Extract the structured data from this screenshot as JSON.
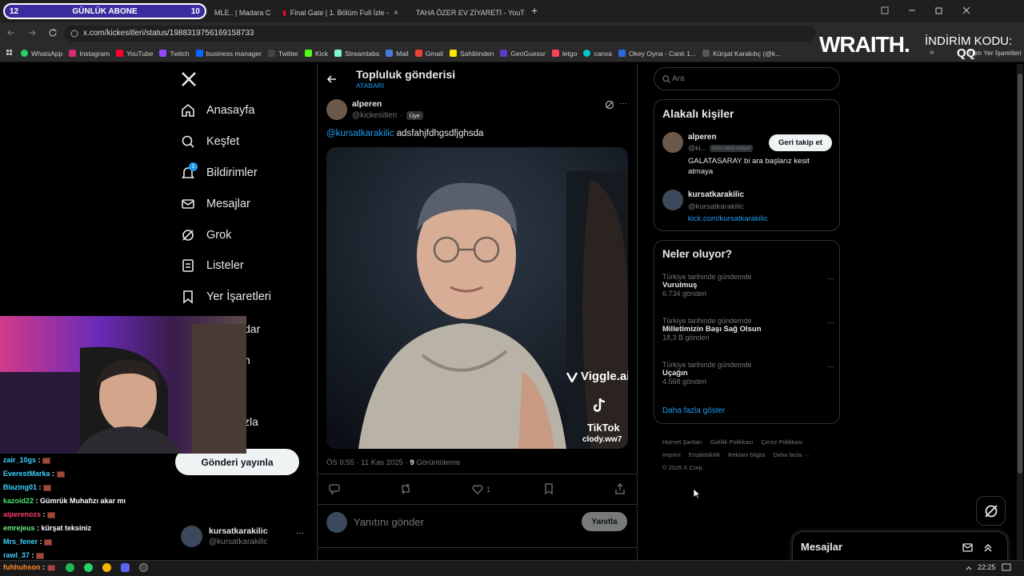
{
  "subgoal": {
    "current": "12",
    "label": "GÜNLÜK ABONE",
    "target": "10"
  },
  "tabs": [
    {
      "label": "MLE.. | Madara C",
      "close": "×"
    },
    {
      "label": "Final Gate | 1. Bölüm Full İzle -",
      "close": "×"
    },
    {
      "label": "TAHA ÖZER EV ZİYARETİ - YouT",
      "close": "×"
    }
  ],
  "new_tab": "+",
  "url": "x.com/kickesitleri/status/1988319756169158733",
  "bookmarks": [
    "WhatsApp",
    "Instagram",
    "YouTube",
    "Twitch",
    "business manager",
    "Twitter",
    "Kick",
    "Streamlabs",
    "Mail",
    "Gmail",
    "Sahibinden",
    "GeoGuessr",
    "letgo",
    "canva",
    "Okey Oyna - Canlı 1...",
    "Kürşat Karakılıç (@k..."
  ],
  "bookmarks_more": "»",
  "bookmarks_folder": "Tüm Yer İşaretleri",
  "overlay": {
    "brand": "WRAITH.",
    "promo": "İNDİRİM KODU:",
    "code": "QQ"
  },
  "nav": {
    "items": [
      "Anasayfa",
      "Keşfet",
      "Bildirimler",
      "Mesajlar",
      "Grok",
      "Listeler",
      "Yer İşaretleri"
    ],
    "notif_count": "1",
    "post_button": "Gönderi yayınla",
    "account_name": "kursatkarakilic",
    "account_handle": "@kursatkarakilic",
    "more": "···"
  },
  "post": {
    "header_title": "Topluluk gönderisi",
    "header_sub": "ATABARI",
    "author": "alperen",
    "handle": "@kickesitleri",
    "dot": "·",
    "badge": "Üye",
    "mention": "@kursatkarakilic",
    "text": " adsfahjfdhgsdfjghsda",
    "watermark1": "Viggle.ai",
    "watermark2": "TikTok",
    "watermark3": "clody.ww7",
    "time": "ÖS 9:55 · 11 Kas 2025 · ",
    "views": "9",
    "views_label": " Görüntüleme",
    "likes": "1",
    "reply_placeholder": "Yanıtını gönder",
    "reply_button": "Yanıtla"
  },
  "search": {
    "placeholder": "Ara"
  },
  "related": {
    "title": "Alakalı kişiler",
    "people": [
      {
        "name": "alperen",
        "handle": "@ki...",
        "follows_you": "Seni takip ediyor",
        "bio": "GALATASARAY bi ara başlarız kesit atmaya",
        "button": "Geri takip et"
      },
      {
        "name": "kursatkarakilic",
        "handle": "@kursatkarakilic",
        "link": "kick.com/kursatkarakilic"
      }
    ]
  },
  "trends": {
    "title": "Neler oluyor?",
    "items": [
      {
        "context": "Türkiye tarihinde gündemde",
        "name": "Vurulmuş",
        "count": "6.734 gönderi"
      },
      {
        "context": "Türkiye tarihinde gündemde",
        "name": "Milletimizin Başı Sağ Olsun",
        "count": "18,3 B gönderi"
      },
      {
        "context": "Türkiye tarihinde gündemde",
        "name": "Uçağın",
        "count": "4.568 gönderi"
      }
    ],
    "more": "Daha fazla göster",
    "menu": "···"
  },
  "footer": {
    "line1": [
      "Hizmet Şartları",
      "Gizlilik Politikası",
      "Çerez Politikası"
    ],
    "line2": [
      "Imprint",
      "Erişilebilirlik",
      "Reklam bilgisi",
      "Daha fazla ···"
    ],
    "copy": "© 2025 X Corp."
  },
  "messages_drawer": {
    "title": "Mesajlar"
  },
  "nav_obscured": [
    "dar",
    "n",
    "zla"
  ],
  "chat": [
    {
      "user": "zair_10gs",
      "msg": "",
      "color": "#3fd0ff"
    },
    {
      "user": "EverestMarka",
      "msg": "",
      "color": "#3fd0ff"
    },
    {
      "user": "Blazing01",
      "msg": "",
      "color": "#3fd0ff"
    },
    {
      "user": "kazoid22",
      "msg": "Gümrük Muhafızı akar mı",
      "color": "#4be06e"
    },
    {
      "user": "alperenozs",
      "msg": "",
      "color": "#ff3d6b"
    },
    {
      "user": "emrejeus",
      "msg": "kürşat teksiniz",
      "color": "#6cf07f"
    },
    {
      "user": "Mrs_fener",
      "msg": "",
      "color": "#3fd0ff"
    },
    {
      "user": "rawl_37",
      "msg": "",
      "color": "#3fd0ff"
    },
    {
      "user": "fuhhuhson",
      "msg": "",
      "color": "#ff8a2b"
    }
  ],
  "chat_sep": " : ",
  "clock": "22:25"
}
